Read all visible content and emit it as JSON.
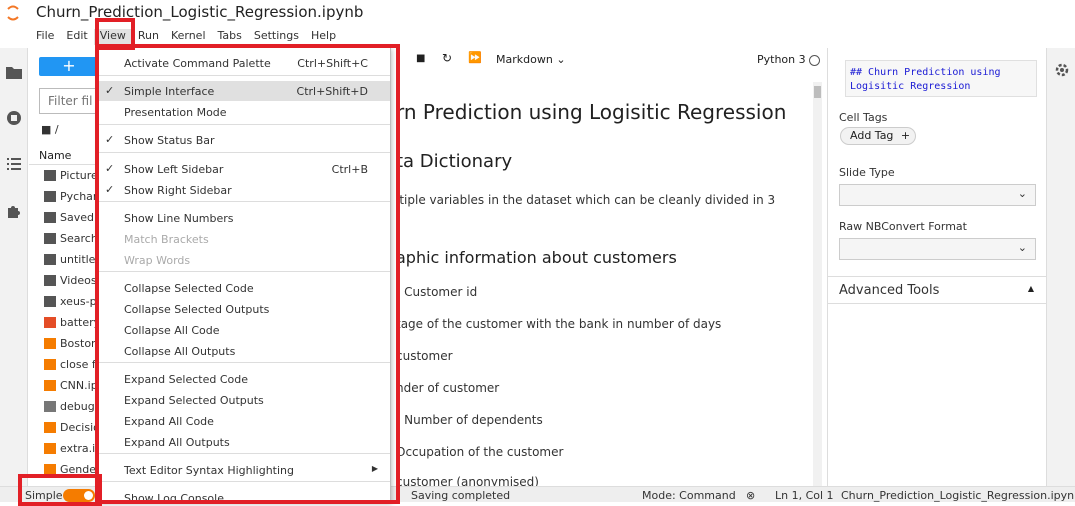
{
  "window": {
    "notebook_title": "Churn_Prediction_Logistic_Regression.ipynb"
  },
  "menubar": {
    "items": [
      "File",
      "Edit",
      "View",
      "Run",
      "Kernel",
      "Tabs",
      "Settings",
      "Help"
    ],
    "active": "View"
  },
  "filebrowser": {
    "new_label": "+",
    "filter_placeholder": "Filter files by name",
    "breadcrumb": "/",
    "column_name": "Name",
    "files": [
      {
        "name": "Pictures",
        "icon": "folder-icon"
      },
      {
        "name": "PycharmProjects",
        "icon": "folder-icon"
      },
      {
        "name": "Saved Games",
        "icon": "folder-icon"
      },
      {
        "name": "Searches",
        "icon": "folder-icon"
      },
      {
        "name": "untitled",
        "icon": "folder-icon"
      },
      {
        "name": "Videos",
        "icon": "folder-icon"
      },
      {
        "name": "xeus-python",
        "icon": "folder-icon"
      },
      {
        "name": "battery",
        "icon": "html-file-icon"
      },
      {
        "name": "Boston",
        "icon": "notebook-icon"
      },
      {
        "name": "close fo",
        "icon": "notebook-icon"
      },
      {
        "name": "CNN.ipynb",
        "icon": "notebook-icon"
      },
      {
        "name": "debug.",
        "icon": "file-icon"
      },
      {
        "name": "Decision",
        "icon": "notebook-icon"
      },
      {
        "name": "extra.ip",
        "icon": "notebook-icon"
      },
      {
        "name": "Gender",
        "icon": "notebook-icon"
      }
    ]
  },
  "notebook_toolbar": {
    "cell_type": "Markdown",
    "kernel": "Python 3"
  },
  "notebook": {
    "h1": "rn Prediction using Logisitic Regression",
    "h2": "ta Dictionary",
    "p1": "ltiple variables in the dataset which can be cleanly divided in 3",
    "h3": "aphic information about customers",
    "lines": [
      "- Customer id",
      "tage of the customer with the bank in number of days",
      "customer",
      "nder of customer",
      "- Number of dependents",
      "Occupation of the customer",
      "customer (anonymised)"
    ]
  },
  "right_panel": {
    "md_preview": "## Churn Prediction using Logisitic Regression",
    "cell_tags_label": "Cell Tags",
    "add_tag_label": "Add Tag",
    "slide_type_label": "Slide Type",
    "raw_format_label": "Raw NBConvert Format",
    "advanced_tools_label": "Advanced Tools"
  },
  "view_menu": {
    "items": [
      {
        "label": "Activate Command Palette",
        "shortcut": "Ctrl+Shift+C",
        "checked": false,
        "disabled": false
      },
      {
        "label": "Simple Interface",
        "shortcut": "Ctrl+Shift+D",
        "checked": true,
        "disabled": false,
        "highlight": true
      },
      {
        "label": "Presentation Mode",
        "shortcut": "",
        "checked": false,
        "disabled": false
      },
      {
        "label": "Show Status Bar",
        "shortcut": "",
        "checked": true,
        "disabled": false
      },
      {
        "label": "Show Left Sidebar",
        "shortcut": "Ctrl+B",
        "checked": true,
        "disabled": false
      },
      {
        "label": "Show Right Sidebar",
        "shortcut": "",
        "checked": true,
        "disabled": false
      },
      {
        "label": "Show Line Numbers",
        "shortcut": "",
        "checked": false,
        "disabled": false
      },
      {
        "label": "Match Brackets",
        "shortcut": "",
        "checked": false,
        "disabled": true
      },
      {
        "label": "Wrap Words",
        "shortcut": "",
        "checked": false,
        "disabled": true
      },
      {
        "label": "Collapse Selected Code",
        "shortcut": "",
        "checked": false,
        "disabled": false
      },
      {
        "label": "Collapse Selected Outputs",
        "shortcut": "",
        "checked": false,
        "disabled": false
      },
      {
        "label": "Collapse All Code",
        "shortcut": "",
        "checked": false,
        "disabled": false
      },
      {
        "label": "Collapse All Outputs",
        "shortcut": "",
        "checked": false,
        "disabled": false
      },
      {
        "label": "Expand Selected Code",
        "shortcut": "",
        "checked": false,
        "disabled": false
      },
      {
        "label": "Expand Selected Outputs",
        "shortcut": "",
        "checked": false,
        "disabled": false
      },
      {
        "label": "Expand All Code",
        "shortcut": "",
        "checked": false,
        "disabled": false
      },
      {
        "label": "Expand All Outputs",
        "shortcut": "",
        "checked": false,
        "disabled": false
      },
      {
        "label": "Text Editor Syntax Highlighting",
        "shortcut": "",
        "checked": false,
        "disabled": false,
        "submenu": true
      },
      {
        "label": "Show Log Console",
        "shortcut": "",
        "checked": false,
        "disabled": false
      }
    ]
  },
  "statusbar": {
    "mode_label": "Simple",
    "simple_enabled": true,
    "saving": "Saving completed",
    "mode": "Mode: Command",
    "position": "Ln 1, Col 1",
    "filename": "Churn_Prediction_Logistic_Regression.ipynb"
  },
  "colors": {
    "accent": "#2196f3",
    "toggle": "#f57c00",
    "annotation": "#e21f26"
  }
}
